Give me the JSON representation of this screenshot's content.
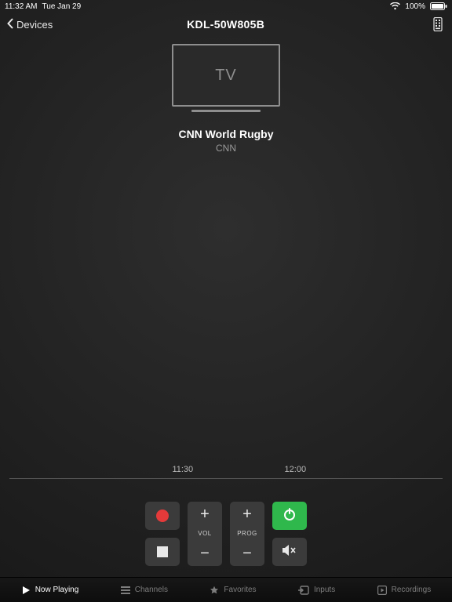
{
  "status": {
    "time": "11:32 AM",
    "date": "Tue Jan 29",
    "battery_pct": "100%"
  },
  "nav": {
    "back_label": "Devices",
    "title": "KDL-50W805B"
  },
  "tv": {
    "label": "TV"
  },
  "program": {
    "title": "CNN World Rugby",
    "channel": "CNN"
  },
  "timeline": {
    "t1": "11:30",
    "t2": "12:00"
  },
  "controls": {
    "vol_label": "VOL",
    "prog_label": "PROG"
  },
  "tabs": {
    "now_playing": "Now Playing",
    "channels": "Channels",
    "favorites": "Favorites",
    "inputs": "Inputs",
    "recordings": "Recordings"
  }
}
